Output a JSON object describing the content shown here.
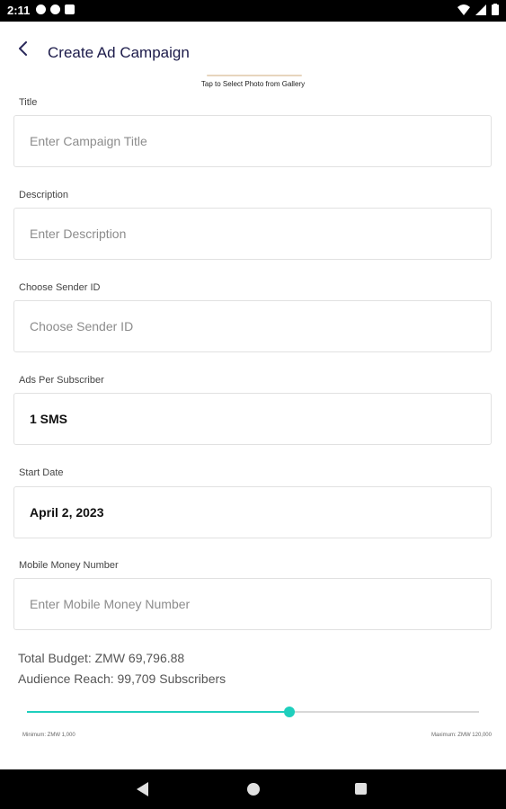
{
  "status_bar": {
    "time": "2:11"
  },
  "app_bar": {
    "title": "Create Ad Campaign"
  },
  "gallery": {
    "hint": "Tap to Select Photo from Gallery"
  },
  "form": {
    "title": {
      "label": "Title",
      "placeholder": "Enter Campaign Title"
    },
    "description": {
      "label": "Description",
      "placeholder": "Enter Description"
    },
    "sender_id": {
      "label": "Choose Sender ID",
      "placeholder": "Choose Sender ID"
    },
    "ads_per_subscriber": {
      "label": "Ads Per Subscriber",
      "value": "1 SMS"
    },
    "start_date": {
      "label": "Start Date",
      "value": "April 2, 2023"
    },
    "mobile_money": {
      "label": "Mobile Money Number",
      "placeholder": "Enter Mobile Money Number"
    }
  },
  "summary": {
    "total_budget": "Total Budget: ZMW 69,796.88",
    "audience_reach": "Audience Reach: 99,709 Subscribers"
  },
  "slider": {
    "fraction": 0.58,
    "min_label": "Minimum: ZMW 1,000",
    "max_label": "Maximum: ZMW 120,000",
    "accent": "#1fcfbd"
  }
}
